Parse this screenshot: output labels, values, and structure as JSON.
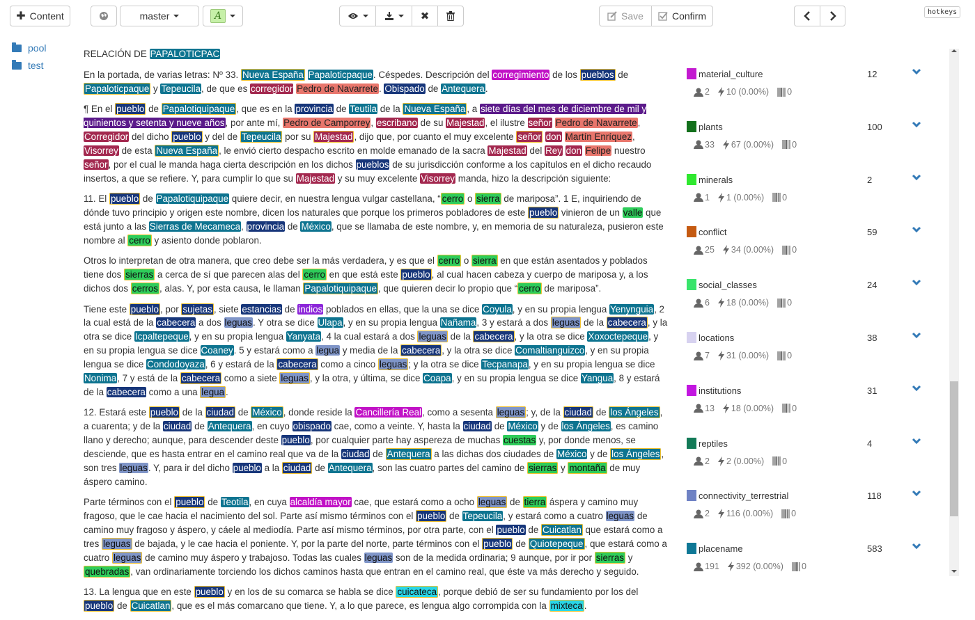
{
  "toolbar": {
    "content_label": "Content",
    "branch_label": "master",
    "save_label": "Save",
    "confirm_label": "Confirm",
    "hotkeys_label": "hotkeys"
  },
  "sidebar": {
    "items": [
      {
        "label": "pool"
      },
      {
        "label": "test"
      }
    ]
  },
  "document": {
    "title_prefix": "RELACIÓN DE ",
    "title_entity": "PAPALOTICPAC"
  },
  "categories": [
    {
      "name": "material_culture",
      "count": "12",
      "users": "2",
      "ops": "10 (0.00%)",
      "codes": "0",
      "color": "#c31ad0"
    },
    {
      "name": "plants",
      "count": "100",
      "users": "33",
      "ops": "67 (0.00%)",
      "codes": "0",
      "color": "#13701c"
    },
    {
      "name": "minerals",
      "count": "2",
      "users": "1",
      "ops": "1 (0.00%)",
      "codes": "0",
      "color": "#2fe82f"
    },
    {
      "name": "conflict",
      "count": "59",
      "users": "25",
      "ops": "34 (0.00%)",
      "codes": "0",
      "color": "#c55a11"
    },
    {
      "name": "social_classes",
      "count": "24",
      "users": "6",
      "ops": "18 (0.00%)",
      "codes": "0",
      "color": "#39e46b"
    },
    {
      "name": "locations",
      "count": "38",
      "users": "7",
      "ops": "31 (0.00%)",
      "codes": "0",
      "color": "#d7d2f0"
    },
    {
      "name": "institutions",
      "count": "31",
      "users": "13",
      "ops": "18 (0.00%)",
      "codes": "0",
      "color": "#c216e0"
    },
    {
      "name": "reptiles",
      "count": "4",
      "users": "2",
      "ops": "2 (0.00%)",
      "codes": "0",
      "color": "#137a57"
    },
    {
      "name": "connectivity_terrestrial",
      "count": "118",
      "users": "2",
      "ops": "116 (0.00%)",
      "codes": "0",
      "color": "#6f82c4"
    },
    {
      "name": "placename",
      "count": "583",
      "users": "191",
      "ops": "392 (0.00%)",
      "codes": "0",
      "color": "#0f7896"
    }
  ]
}
